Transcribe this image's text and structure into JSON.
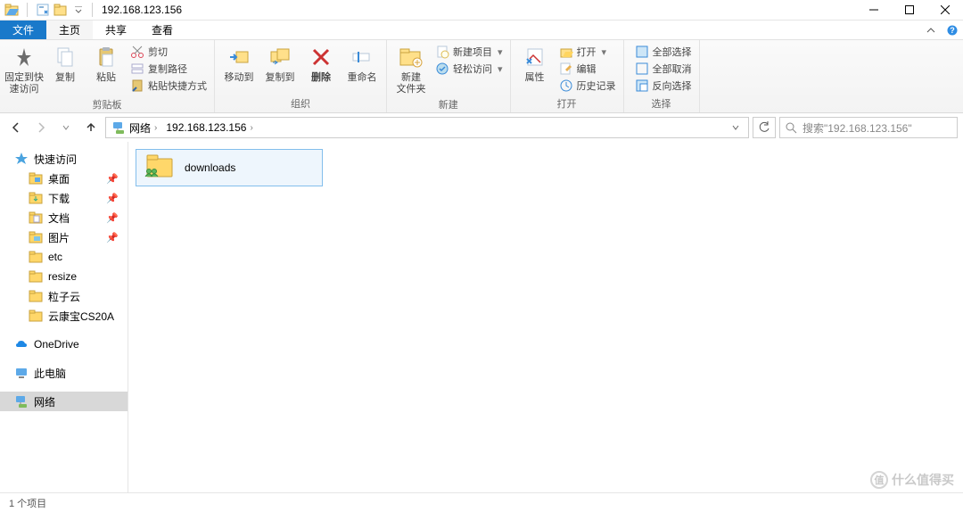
{
  "title": "192.168.123.156",
  "tabs": {
    "file": "文件",
    "home": "主页",
    "share": "共享",
    "view": "查看"
  },
  "ribbon": {
    "pin_quick": "固定到快\n速访问",
    "copy": "复制",
    "paste": "粘贴",
    "cut": "剪切",
    "copy_path": "复制路径",
    "paste_shortcut": "粘贴快捷方式",
    "group_clipboard": "剪贴板",
    "move_to": "移动到",
    "copy_to": "复制到",
    "delete": "删除",
    "rename": "重命名",
    "group_organize": "组织",
    "new_folder": "新建\n文件夹",
    "new_item": "新建项目",
    "easy_access": "轻松访问",
    "group_new": "新建",
    "properties": "属性",
    "open": "打开",
    "edit": "编辑",
    "history": "历史记录",
    "group_open": "打开",
    "select_all": "全部选择",
    "select_none": "全部取消",
    "invert_sel": "反向选择",
    "group_select": "选择"
  },
  "breadcrumb": {
    "network": "网络",
    "address": "192.168.123.156"
  },
  "search": {
    "placeholder": "搜索\"192.168.123.156\""
  },
  "sidebar": {
    "quick_access": "快速访问",
    "items": [
      {
        "label": "桌面",
        "pinned": true
      },
      {
        "label": "下载",
        "pinned": true
      },
      {
        "label": "文档",
        "pinned": true
      },
      {
        "label": "图片",
        "pinned": true
      },
      {
        "label": "etc",
        "pinned": false
      },
      {
        "label": "resize",
        "pinned": false
      },
      {
        "label": "粒子云",
        "pinned": false
      },
      {
        "label": "云康宝CS20A",
        "pinned": false
      }
    ],
    "onedrive": "OneDrive",
    "this_pc": "此电脑",
    "network": "网络"
  },
  "content": {
    "folder_name": "downloads"
  },
  "status": {
    "count": "1 个项目"
  },
  "watermark": "什么值得买"
}
